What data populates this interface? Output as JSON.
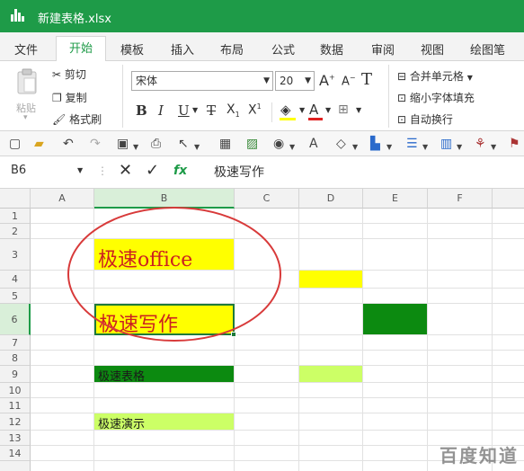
{
  "titlebar": {
    "doc_title": "新建表格.xlsx",
    "accent": "#1e9b48"
  },
  "menu": {
    "items": [
      "文件",
      "开始",
      "模板",
      "插入",
      "布局",
      "公式",
      "数据",
      "审阅",
      "视图",
      "绘图笔"
    ],
    "active": "开始"
  },
  "ribbon": {
    "paste": "粘贴",
    "cut": "剪切",
    "copy": "复制",
    "format_painter": "格式刷",
    "font_name": "宋体",
    "font_size": "20",
    "merge_center": "合并单元格",
    "shrink_fit": "缩小字体填充",
    "wrap_text": "自动换行"
  },
  "formula_bar": {
    "cell_ref": "B6",
    "fx": "fx",
    "content": "极速写作"
  },
  "columns": [
    "A",
    "B",
    "C",
    "D",
    "E",
    "F"
  ],
  "rows": [
    "1",
    "2",
    "3",
    "4",
    "5",
    "6",
    "7",
    "8",
    "9",
    "10",
    "11",
    "12",
    "13",
    "14"
  ],
  "cells": {
    "B3": "极速office",
    "B6": "极速写作",
    "B9": "极速表格",
    "B12": "极速演示"
  },
  "colors": {
    "yellow": "#ffff00",
    "dark_green": "#0c8a10",
    "light_green": "#ccff66",
    "red_text": "#cc2020",
    "circle": "#d83a3a"
  },
  "watermark": "百度知道"
}
